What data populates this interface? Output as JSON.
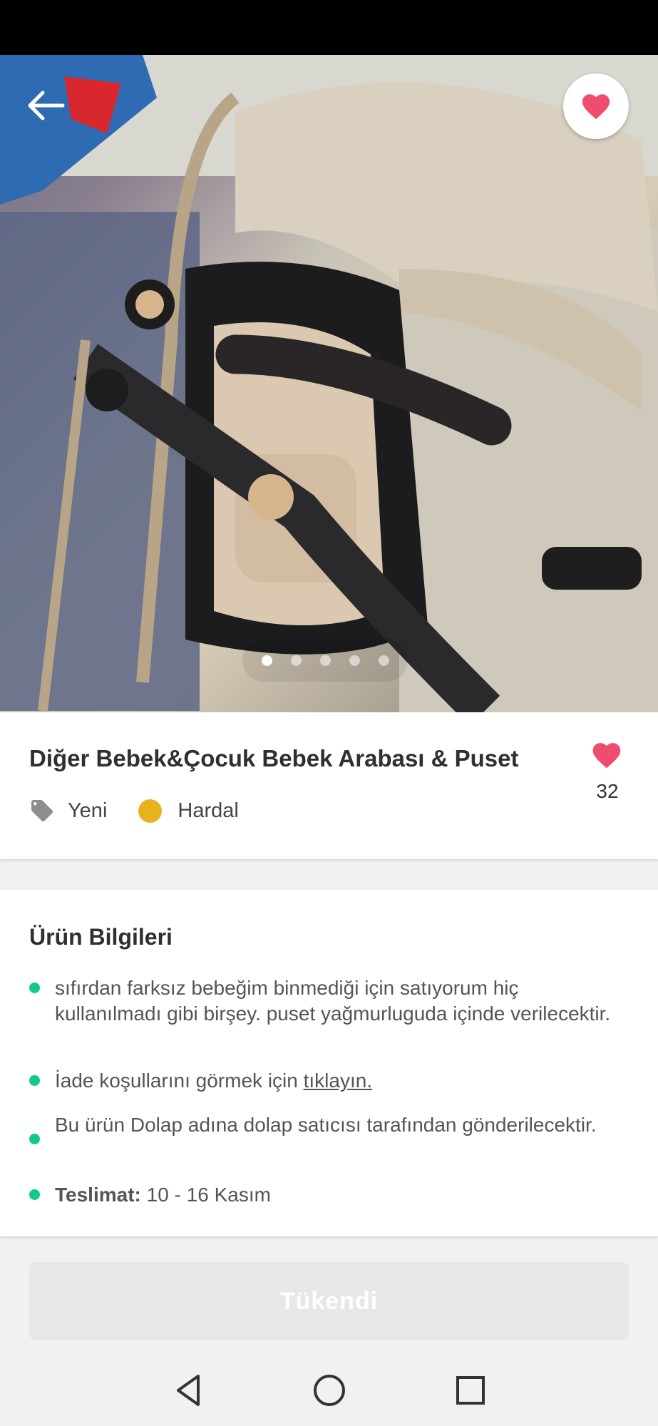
{
  "product": {
    "title": "Diğer Bebek&Çocuk Bebek Arabası & Puset",
    "condition": "Yeni",
    "color_name": "Hardal",
    "color_hex": "#e8b21c",
    "like_count": "32"
  },
  "gallery": {
    "total_images": 5,
    "current_index": 0
  },
  "info": {
    "heading": "Ürün Bilgileri",
    "description": "sıfırdan farksız bebeğim binmediği için satıyorum hiç kullanılmadı gibi birşey. puset yağmurluguda içinde verilecektir.",
    "return_text": "İade koşullarını görmek için ",
    "return_link": "tıklayın.",
    "shipping_note": "Bu ürün Dolap adına dolap satıcısı tarafından gönderilecektir.",
    "delivery_label": "Teslimat:",
    "delivery_value": " 10 - 16 Kasım"
  },
  "cta": {
    "label": "Tükendi"
  },
  "colors": {
    "accent_green": "#10c98b",
    "heart_pink": "#ee4d6e"
  },
  "icons": [
    "back-arrow-icon",
    "heart-icon",
    "tag-icon",
    "nav-back-icon",
    "nav-home-icon",
    "nav-recents-icon"
  ]
}
